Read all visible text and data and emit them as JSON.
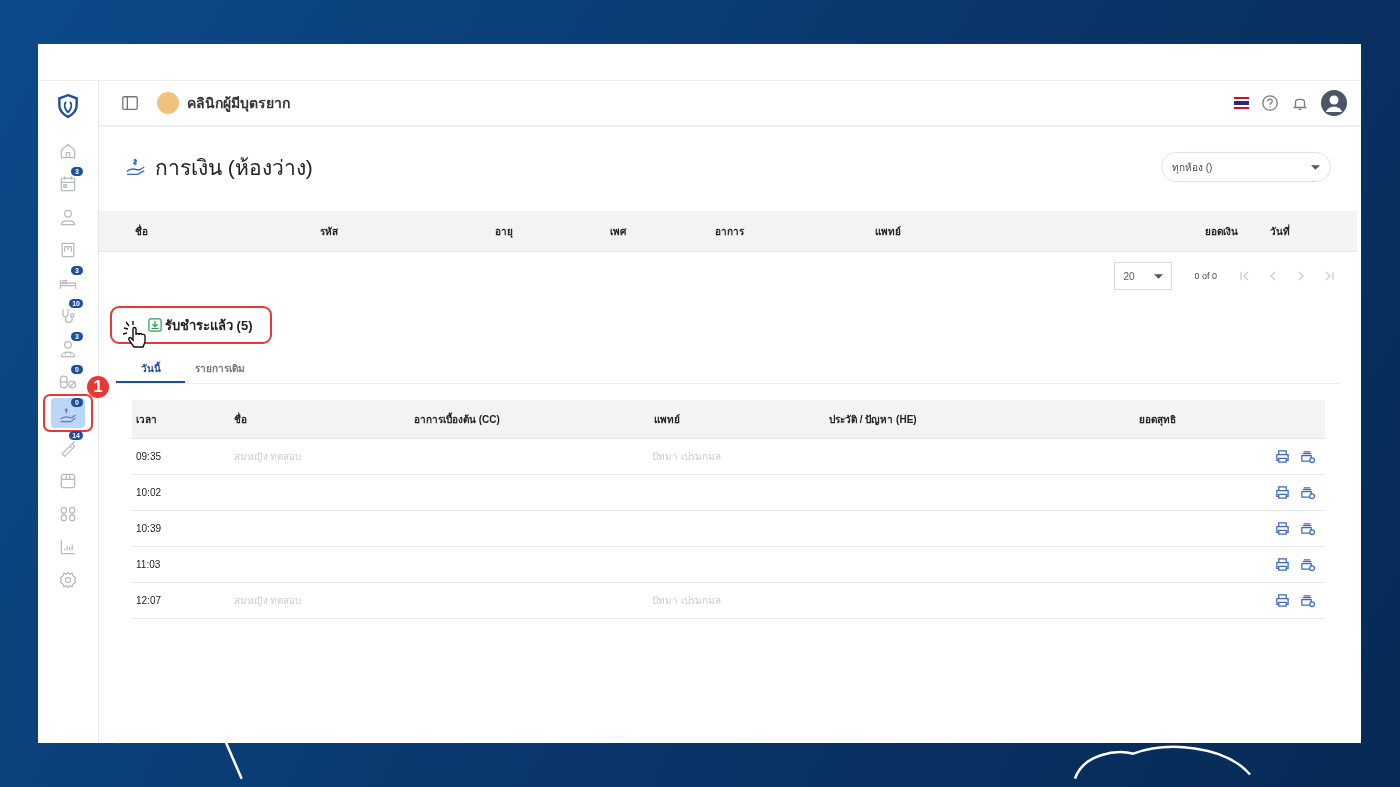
{
  "header": {
    "clinic_name": "คลินิกผู้มีบุตรยาก"
  },
  "sidebar": {
    "items": [
      {
        "selected": false
      },
      {
        "badge": "3",
        "selected": false
      },
      {
        "selected": false
      },
      {
        "selected": false
      },
      {
        "badge": "3",
        "selected": false
      },
      {
        "badge": "10",
        "selected": false
      },
      {
        "badge": "3",
        "selected": false
      },
      {
        "badge": "0",
        "selected": false
      },
      {
        "badge": "0",
        "selected": true
      },
      {
        "badge": "14",
        "selected": false
      },
      {
        "selected": false
      },
      {
        "selected": false
      },
      {
        "selected": false
      },
      {
        "selected": false
      }
    ]
  },
  "page_title": "การเงิน (ห้องว่าง)",
  "room_select": {
    "value": "ทุกห้อง ()"
  },
  "queue_table": {
    "columns": [
      "ชื่อ",
      "รหัส",
      "อายุ",
      "เพศ",
      "อาการ",
      "แพทย์",
      "ยอดเงิน",
      "วันที่"
    ]
  },
  "pagination": {
    "page_size": "20",
    "range": "0 of 0"
  },
  "paid_button": {
    "label": "รับชำระแล้ว (5)"
  },
  "tabs": [
    {
      "label": "วันนี้",
      "selected": true
    },
    {
      "label": "รายการเดิม",
      "selected": false
    }
  ],
  "paid_table": {
    "columns": [
      "เวลา",
      "ชื่อ",
      "อาการเบื้องต้น (CC)",
      "แพทย์",
      "ประวัติ / ปัญหา (HE)",
      "ยอดสุทธิ"
    ],
    "rows": [
      {
        "time": "09:35",
        "name": "สมหญิง ทดสอบ",
        "doctor": "ปัทมา เปรมกมล"
      },
      {
        "time": "10:02",
        "name": null,
        "doctor": null
      },
      {
        "time": "10:39",
        "name": null,
        "doctor": null
      },
      {
        "time": "11:03",
        "name": null,
        "doctor": null
      },
      {
        "time": "12:07",
        "name": "สมหญิง ทดสอบ",
        "doctor": "ปัทมา เปรมกมล"
      }
    ]
  },
  "callout": {
    "step": "1"
  }
}
